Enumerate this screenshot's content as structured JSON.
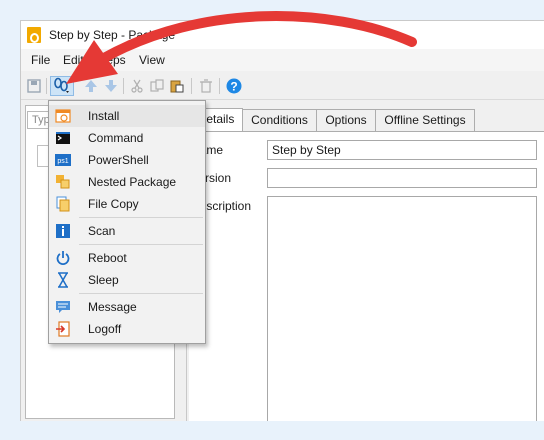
{
  "window": {
    "title": "Step by Step - Package"
  },
  "menubar": {
    "items": [
      "File",
      "Edit",
      "Steps",
      "View"
    ]
  },
  "search": {
    "placeholder": "Typ"
  },
  "tabs": [
    {
      "label": "Details",
      "active": true
    },
    {
      "label": "Conditions",
      "active": false
    },
    {
      "label": "Options",
      "active": false
    },
    {
      "label": "Offline Settings",
      "active": false
    }
  ],
  "details": {
    "name_label": "Name",
    "name_value": "Step by Step",
    "version_label": "Version",
    "version_value": "",
    "description_label": "Description",
    "description_value": ""
  },
  "add_step_menu": {
    "items": [
      {
        "label": "Install",
        "icon": "install-icon"
      },
      {
        "label": "Command",
        "icon": "command-icon"
      },
      {
        "label": "PowerShell",
        "icon": "powershell-icon"
      },
      {
        "label": "Nested Package",
        "icon": "nested-package-icon"
      },
      {
        "label": "File Copy",
        "icon": "file-copy-icon"
      },
      {
        "label": "Scan",
        "icon": "scan-icon"
      },
      {
        "label": "Reboot",
        "icon": "power-icon"
      },
      {
        "label": "Sleep",
        "icon": "hourglass-icon"
      },
      {
        "label": "Message",
        "icon": "message-icon"
      },
      {
        "label": "Logoff",
        "icon": "logoff-icon"
      }
    ]
  },
  "colors": {
    "arrow": "#e53935",
    "accent_blue": "#1e88e5",
    "app_icon": "#f2a900"
  }
}
